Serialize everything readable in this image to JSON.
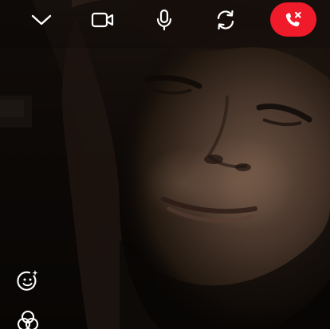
{
  "call": {
    "top_controls": [
      {
        "key": "collapse",
        "icon": "chevron-down-icon",
        "label": "Minimize call"
      },
      {
        "key": "camera",
        "icon": "video-camera-icon",
        "label": "Camera"
      },
      {
        "key": "mic",
        "icon": "microphone-icon",
        "label": "Microphone"
      },
      {
        "key": "switch",
        "icon": "switch-camera-icon",
        "label": "Switch camera"
      },
      {
        "key": "end",
        "icon": "end-call-icon",
        "label": "End call"
      }
    ],
    "side_controls": [
      {
        "key": "effects",
        "icon": "sparkle-face-icon",
        "label": "Effects"
      },
      {
        "key": "filters",
        "icon": "filters-icon",
        "label": "Filters"
      }
    ],
    "colors": {
      "end_call": "#f01b2a",
      "icon": "#ffffff",
      "video_background": "#070504"
    }
  }
}
